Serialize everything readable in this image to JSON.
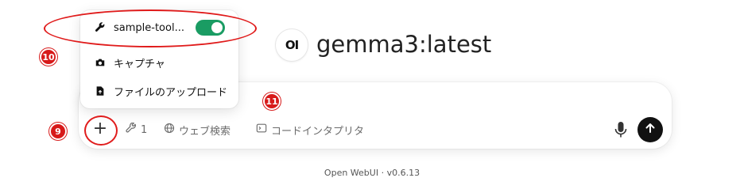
{
  "model": {
    "logo_text": "OI",
    "name": "gemma3:latest"
  },
  "menu": {
    "items": [
      {
        "label": "sample-tool...",
        "icon": "wrench-icon",
        "toggle_on": true
      },
      {
        "label": "キャプチャ",
        "icon": "camera-icon"
      },
      {
        "label": "ファイルのアップロード",
        "icon": "file-upload-icon"
      }
    ]
  },
  "toolbar": {
    "plus_label": "+",
    "tools_count": "1",
    "web_search_label": "ウェブ検索",
    "code_interpreter_label": "コードインタプリタ"
  },
  "annotations": {
    "badge_9": "9",
    "badge_10": "10",
    "badge_11": "11"
  },
  "footer": {
    "text": "Open WebUI · v0.6.13"
  },
  "colors": {
    "toggle_on": "#1a9c63",
    "annotation_red": "#d71a1a",
    "send_button": "#111111"
  }
}
